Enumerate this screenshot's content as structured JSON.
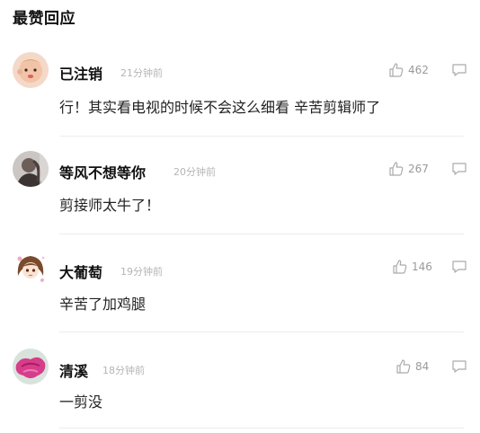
{
  "section_title": "最赞回应",
  "comments": [
    {
      "name": "已注销",
      "time": "21分钟前",
      "likes": "462",
      "text": "行！其实看电视的时候不会这么细看 辛苦剪辑师了",
      "avatar": "baby-avatar"
    },
    {
      "name": "等风不想等你",
      "time": "20分钟前",
      "likes": "267",
      "text": "剪接师太牛了！",
      "avatar": "portrait-avatar"
    },
    {
      "name": "大葡萄",
      "time": "19分钟前",
      "likes": "146",
      "text": "辛苦了加鸡腿",
      "avatar": "anime-girl-avatar"
    },
    {
      "name": "清溪",
      "time": "18分钟前",
      "likes": "84",
      "text": "一剪没",
      "avatar": "pink-flower-avatar"
    }
  ]
}
